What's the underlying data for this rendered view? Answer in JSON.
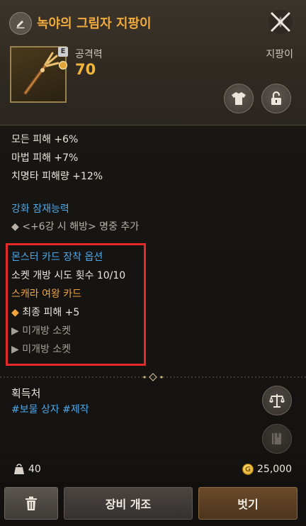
{
  "header": {
    "title": "녹야의 그림자 지팡이",
    "grade_badge": "E",
    "stat_label": "공격력",
    "stat_value": "70",
    "item_type": "지팡이"
  },
  "options": [
    "모든 피해 +6%",
    "마법 피해 +7%",
    "치명타 피해량 +12%"
  ],
  "enhance": {
    "title": "강화 잠재능력",
    "item": "◆ <+6강 시 해방> 명중 추가"
  },
  "monster_card": {
    "title": "몬스터 카드 장착 옵션",
    "socket_attempts": "소켓 개방 시도 횟수 10/10",
    "card_name": "스캐라 여왕 카드",
    "card_effect_marker": "◆",
    "card_effect": "최종 피해 +5",
    "locked_1": "▶ 미개방 소켓",
    "locked_2": "▶ 미개방 소켓"
  },
  "acquire": {
    "title": "획득처",
    "tags": "#보물 상자 #제작"
  },
  "footer": {
    "weight": "40",
    "gold": "25,000"
  },
  "buttons": {
    "modify": "장비 개조",
    "unequip": "벗기"
  },
  "colors": {
    "title": "#f0ab3c",
    "section": "#4ea7e8",
    "card": "#f0a43c",
    "highlight": "#e22a2a"
  },
  "icons": [
    "edit-icon",
    "close-icon",
    "staff-icon",
    "outfit-icon",
    "unlock-icon",
    "scale-icon",
    "book-icon",
    "bag-icon",
    "gold-coin-icon",
    "trash-icon"
  ]
}
